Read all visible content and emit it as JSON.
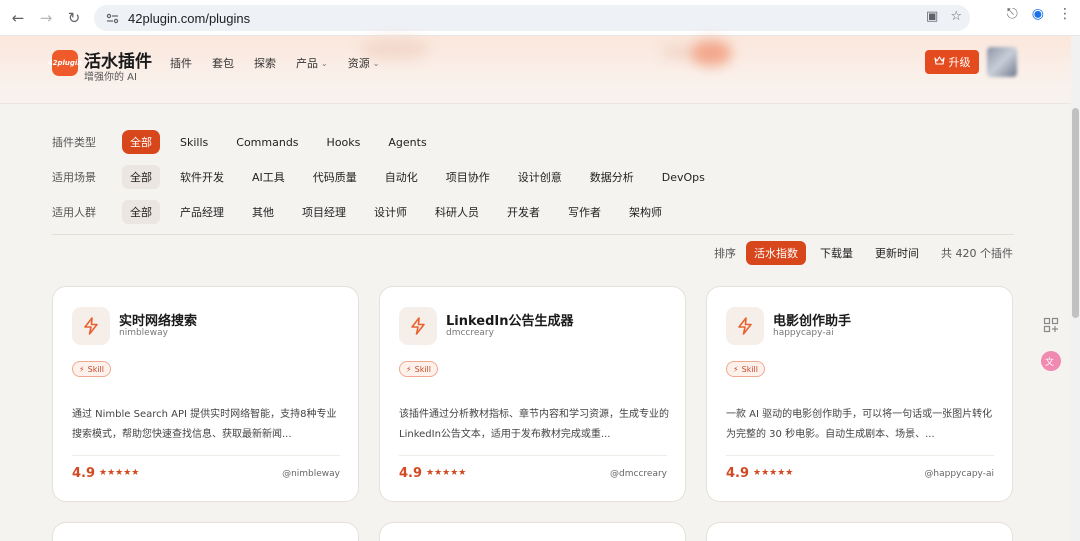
{
  "browser": {
    "url": "42plugin.com/plugins"
  },
  "header": {
    "logo_text": "42plugin",
    "brand": "活水插件",
    "brand_sub": "增强你的 AI",
    "nav": [
      {
        "label": "插件",
        "dropdown": false
      },
      {
        "label": "套包",
        "dropdown": false
      },
      {
        "label": "探索",
        "dropdown": false
      },
      {
        "label": "产品",
        "dropdown": true
      },
      {
        "label": "资源",
        "dropdown": true
      }
    ],
    "upgrade_label": "升级"
  },
  "filters": {
    "type": {
      "label": "插件类型",
      "options": [
        "全部",
        "Skills",
        "Commands",
        "Hooks",
        "Agents"
      ],
      "selected": "全部"
    },
    "scene": {
      "label": "适用场景",
      "options": [
        "全部",
        "软件开发",
        "AI工具",
        "代码质量",
        "自动化",
        "项目协作",
        "设计创意",
        "数据分析",
        "DevOps"
      ],
      "selected": "全部"
    },
    "audience": {
      "label": "适用人群",
      "options": [
        "全部",
        "产品经理",
        "其他",
        "项目经理",
        "设计师",
        "科研人员",
        "开发者",
        "写作者",
        "架构师"
      ],
      "selected": "全部"
    }
  },
  "sort": {
    "label": "排序",
    "options": [
      "活水指数",
      "下载量",
      "更新时间"
    ],
    "selected": "活水指数",
    "count_text": "共 420 个插件"
  },
  "cards": [
    {
      "title": "实时网络搜索",
      "author": "nimbleway",
      "tag": "Skill",
      "desc": "通过 Nimble Search API 提供实时网络智能，支持8种专业搜索模式，帮助您快速查找信息、获取最新新闻...",
      "rating": "4.9",
      "stars": 5,
      "handle": "@nimbleway"
    },
    {
      "title": "LinkedIn公告生成器",
      "author": "dmccreary",
      "tag": "Skill",
      "desc": "该插件通过分析教材指标、章节内容和学习资源，生成专业的LinkedIn公告文本，适用于发布教材完成或重...",
      "rating": "4.9",
      "stars": 5,
      "handle": "@dmccreary"
    },
    {
      "title": "电影创作助手",
      "author": "happycapy-ai",
      "tag": "Skill",
      "desc": "一款 AI 驱动的电影创作助手，可以将一句话或一张图片转化为完整的 30 秒电影。自动生成剧本、场景、...",
      "rating": "4.9",
      "stars": 5,
      "handle": "@happycapy-ai"
    }
  ],
  "colors": {
    "accent": "#d8461c",
    "star": "#d04a22"
  }
}
